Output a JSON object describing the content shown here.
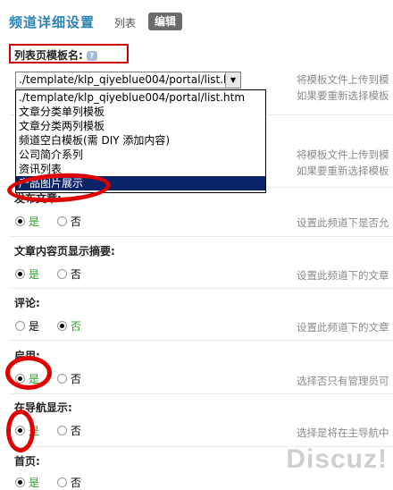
{
  "header": {
    "title": "频道详细设置",
    "tab_list": "列表",
    "tab_edit": "编辑"
  },
  "list_template": {
    "label": "列表页模板名:",
    "select_value": "./template/klp_qiyeblue004/portal/list.htm",
    "options": [
      "./template/klp_qiyeblue004/portal/list.htm",
      "文章分类单列模板",
      "文章分类两列模板",
      "频道空白模板(需 DIY 添加内容)",
      "公司简介系列",
      "资讯列表",
      "产品图片展示"
    ],
    "selected_index": 6,
    "help_1": "将模板文件上传到模",
    "help_2": "如果要重新选择模板"
  },
  "view_template": {
    "help_1": "将模板文件上传到模",
    "help_2": "如果要重新选择模板"
  },
  "publish_article": {
    "label": "发布文章:",
    "options": [
      "是",
      "否"
    ],
    "selected": 0,
    "help": "设置此频道下是否允"
  },
  "show_summary": {
    "label": "文章内容页显示摘要:",
    "options": [
      "是",
      "否"
    ],
    "selected": 0,
    "help": "设置此频道下的文章"
  },
  "comment": {
    "label": "评论:",
    "options": [
      "是",
      "否"
    ],
    "selected": 1,
    "help": "设置此频道下的文章"
  },
  "enabled": {
    "label": "启用:",
    "options": [
      "是",
      "否"
    ],
    "selected": 0,
    "help": "选择否只有管理员可"
  },
  "nav_show": {
    "label": "在导航显示:",
    "options": [
      "是",
      "否"
    ],
    "selected": 0,
    "help": "选择是将在主导航中"
  },
  "homepage": {
    "label": "首页:",
    "options": [
      "是",
      "否"
    ],
    "selected": 0
  },
  "watermark": "Discuz!"
}
